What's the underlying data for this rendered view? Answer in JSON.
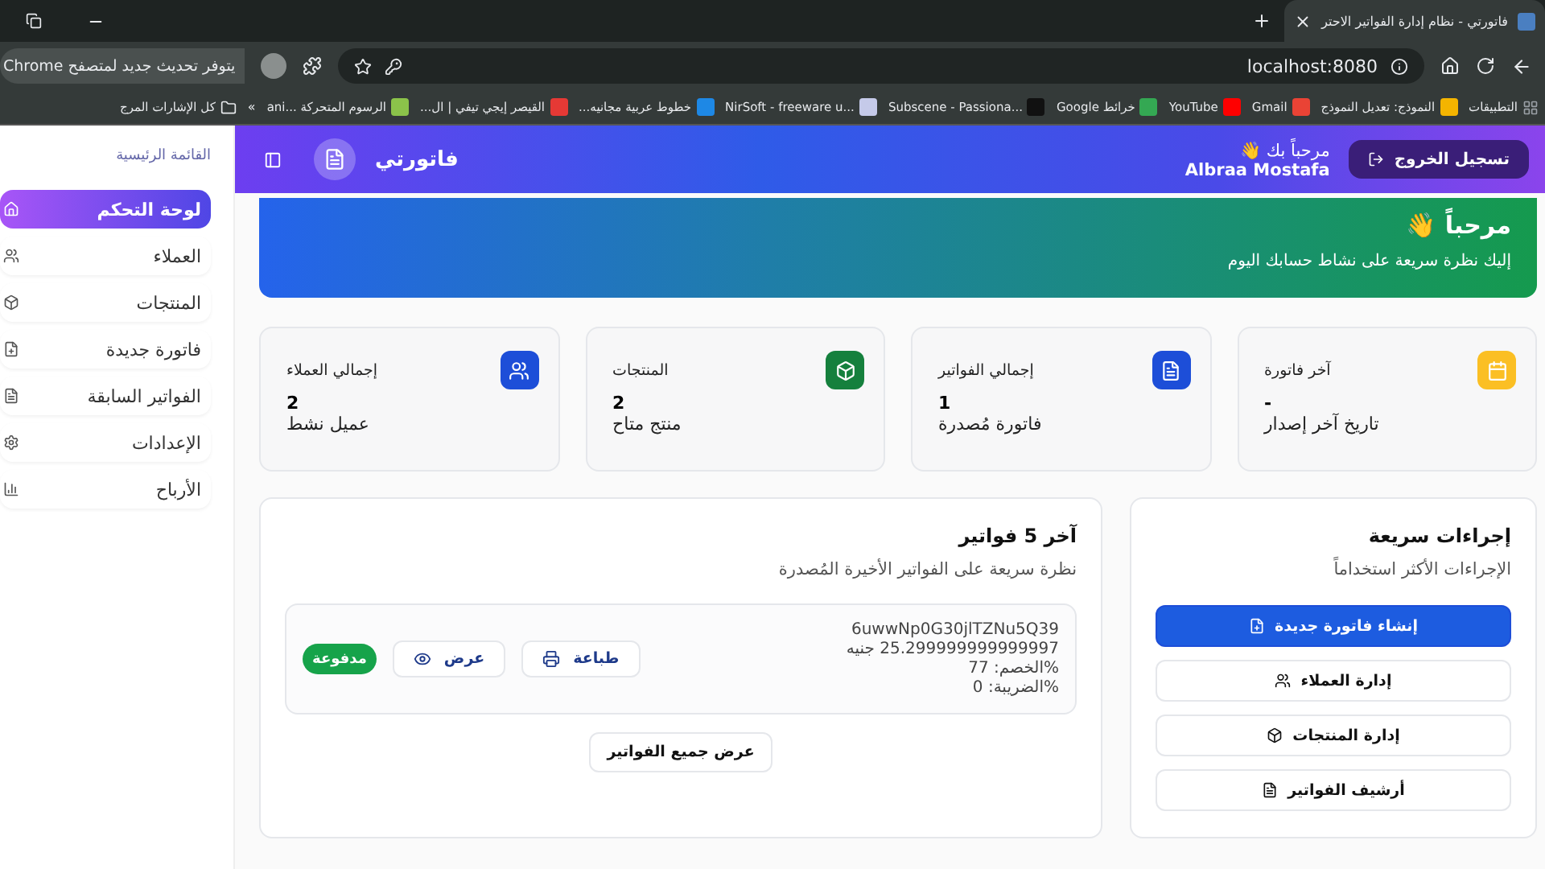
{
  "browser": {
    "tab": {
      "title": "فاتورتي - نظام إدارة الفواتير الاحتر",
      "selected": true
    },
    "address": "localhost:8080",
    "update_button": "يتوفر تحديث جديد لمتصفح Chrome",
    "bookmarks": [
      {
        "label": "التطبيقات",
        "color": "#9aa0a6"
      },
      {
        "label": "النموذج: تعديل النموذج",
        "color": "#f4b400"
      },
      {
        "label": "Gmail",
        "color": "#ea4335"
      },
      {
        "label": "YouTube",
        "color": "#ff0000"
      },
      {
        "label": "خرائط Google",
        "color": "#34a853"
      },
      {
        "label": "Subscene - Passiona...",
        "color": "#111111"
      },
      {
        "label": "NirSoft - freeware u...",
        "color": "#c5cae9"
      },
      {
        "label": "خطوط عربية مجانيه...",
        "color": "#1e88e5"
      },
      {
        "label": "القيصر إيجي تيفي | ال...",
        "color": "#e53935"
      },
      {
        "label": "الرسوم المتحركة ...ani",
        "color": "#8bc34a"
      }
    ],
    "overflow": "»",
    "all_bookmarks": "كل الإشارات المرج"
  },
  "header": {
    "brand": "فاتورتي",
    "greeting": "مرحباً بك 👋",
    "user": "Albraa Mostafa",
    "logout": "تسجيل الخروج"
  },
  "sidebar": {
    "title": "القائمة الرئيسية",
    "items": [
      {
        "label": "لوحة التحكم",
        "selected": true
      },
      {
        "label": "العملاء",
        "selected": false
      },
      {
        "label": "المنتجات",
        "selected": false
      },
      {
        "label": "فاتورة جديدة",
        "selected": false
      },
      {
        "label": "الفواتير السابقة",
        "selected": false
      },
      {
        "label": "الإعدادات",
        "selected": false
      },
      {
        "label": "الأرباح",
        "selected": false
      }
    ]
  },
  "banner": {
    "title": "مرحباً 👋",
    "subtitle": "إليك نظرة سريعة على نشاط حسابك اليوم"
  },
  "stats": [
    {
      "label": "آخر فاتورة",
      "value": "-",
      "note": "تاريخ آخر إصدار",
      "color": "#fbbf24"
    },
    {
      "label": "إجمالي الفواتير",
      "value": "1",
      "note": "فاتورة مُصدرة",
      "color": "#1d4ed8"
    },
    {
      "label": "المنتجات",
      "value": "2",
      "note": "منتج متاح",
      "color": "#15803d"
    },
    {
      "label": "إجمالي العملاء",
      "value": "2",
      "note": "عميل نشط",
      "color": "#1d4ed8"
    }
  ],
  "recent": {
    "title": "آخر 5 فواتير",
    "subtitle": "نظرة سريعة على الفواتير الأخيرة المُصدرة",
    "invoices": [
      {
        "id": "6uwwNp0G30jlTZNu5Q39",
        "amount": "25.299999999999997 جنيه",
        "discount": "%الخصم: 77",
        "tax": "%الضريبة: 0",
        "print": "طباعة",
        "view": "عرض",
        "status": "مدفوعة"
      }
    ],
    "view_all": "عرض جميع الفواتير"
  },
  "quick": {
    "title": "إجراءات سريعة",
    "subtitle": "الإجراءات الأكثر استخداماً",
    "actions": [
      {
        "label": "إنشاء فاتورة جديدة",
        "kind": "primary"
      },
      {
        "label": "إدارة العملاء",
        "kind": "default"
      },
      {
        "label": "إدارة المنتجات",
        "kind": "default"
      },
      {
        "label": "أرشيف الفواتير",
        "kind": "default"
      }
    ]
  }
}
